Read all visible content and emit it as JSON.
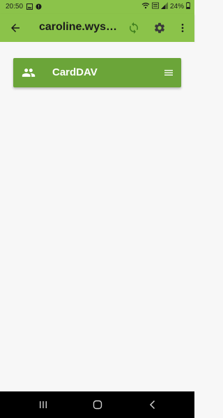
{
  "status_bar": {
    "time": "20:50",
    "battery": "24%",
    "icons_left": [
      "gallery-icon",
      "alert-icon"
    ],
    "icons_right": [
      "wifi-icon",
      "volte-icon",
      "signal-icon",
      "battery-icon"
    ]
  },
  "app_bar": {
    "title": "caroline.wyss...",
    "back_icon": "arrow-back-icon",
    "actions": [
      "sync-icon",
      "settings-icon",
      "more-vert-icon"
    ]
  },
  "card": {
    "title": "CardDAV",
    "icon": "contacts-icon",
    "menu_icon": "menu-icon"
  },
  "nav_bar": {
    "buttons": [
      "recents-button",
      "home-button",
      "back-button"
    ]
  },
  "colors": {
    "app_bar": "#8bc34a",
    "card": "#6ba539",
    "background": "#f7f7f7",
    "nav_bar": "#000000",
    "accent_icon": "#3f7f1e"
  }
}
